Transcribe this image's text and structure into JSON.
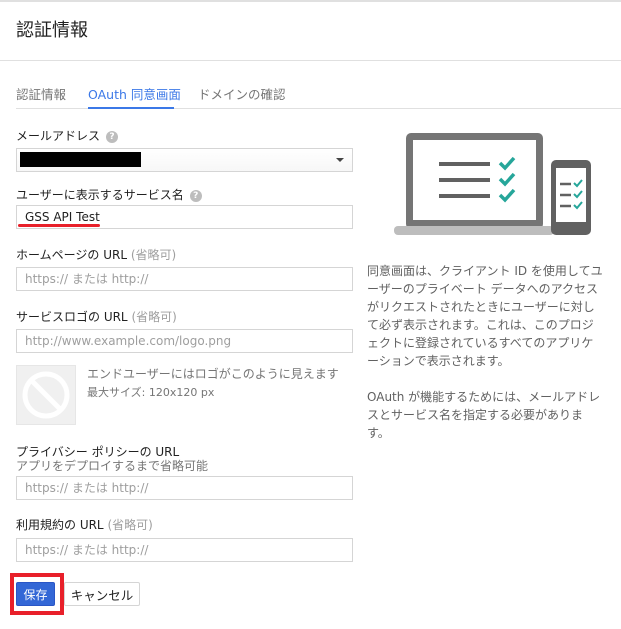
{
  "header": {
    "title": "認証情報"
  },
  "tabs": [
    {
      "label": "認証情報",
      "active": false
    },
    {
      "label": "OAuth 同意画面",
      "active": true
    },
    {
      "label": "ドメインの確認",
      "active": false
    }
  ],
  "form": {
    "email": {
      "label": "メールアドレス",
      "value": ""
    },
    "service_name": {
      "label": "ユーザーに表示するサービス名",
      "value": "GSS API Test"
    },
    "homepage": {
      "label": "ホームページの URL",
      "optional": "(省略可)",
      "placeholder": "https:// または http://"
    },
    "logo": {
      "label": "サービスロゴの URL",
      "optional": "(省略可)",
      "placeholder": "http://www.example.com/logo.png",
      "preview_text": "エンドユーザーにはロゴがこのように見えます",
      "max_size": "最大サイズ: 120x120 px"
    },
    "privacy": {
      "label": "プライバシー ポリシーの URL",
      "sublabel": "アプリをデプロイするまで省略可能",
      "placeholder": "https:// または http://"
    },
    "tos": {
      "label": "利用規約の URL",
      "optional": "(省略可)",
      "placeholder": "https:// または http://"
    }
  },
  "buttons": {
    "save": "保存",
    "cancel": "キャンセル"
  },
  "info": {
    "p1": "同意画面は、クライアント ID を使用してユーザーのプライベート データへのアクセスがリクエストされたときにユーザーに対して必ず表示されます。これは、このプロジェクトに登録されているすべてのアプリケーションで表示されます。",
    "p2": "OAuth が機能するためには、メールアドレスとサービス名を指定する必要があります。"
  },
  "colors": {
    "accent": "#3b78e7",
    "primary_button": "#3367d6",
    "highlight": "#e8202a",
    "check": "#26a69a"
  }
}
